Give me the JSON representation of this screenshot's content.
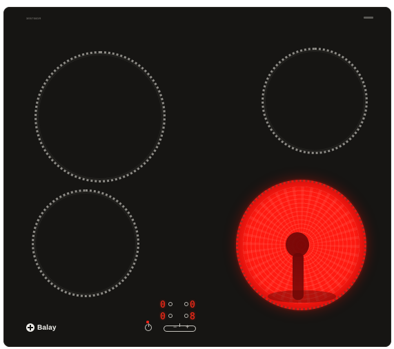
{
  "product": {
    "brand": "Balay",
    "model_code": "3EB750DR"
  },
  "displays": [
    {
      "value": "0"
    },
    {
      "value": "0"
    },
    {
      "value": "0"
    },
    {
      "value": "8"
    }
  ],
  "controls": {
    "minus_label": "−",
    "plus_label": "+"
  },
  "colors": {
    "glass": "#161513",
    "ring": "#8f8d88",
    "heat": "#ff1b12",
    "display_red": "#ff2a18",
    "control_white": "#c7c5bf"
  },
  "icons": {
    "power": "power-icon",
    "logo": "brand-logo-icon"
  }
}
